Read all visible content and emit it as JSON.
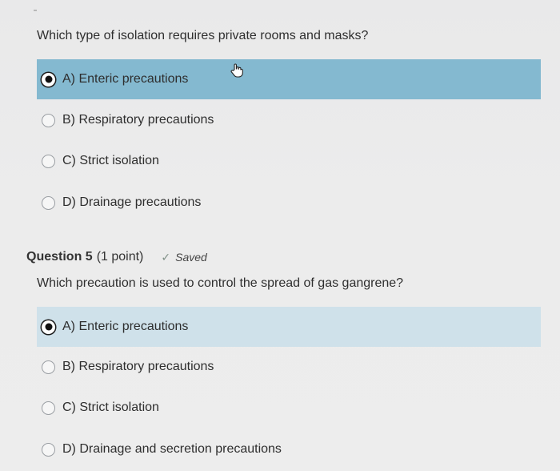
{
  "question4": {
    "prompt": "Which type of isolation requires private rooms and masks?",
    "options": [
      {
        "label": "A) Enteric precautions",
        "selected": true
      },
      {
        "label": "B) Respiratory precautions",
        "selected": false
      },
      {
        "label": "C) Strict isolation",
        "selected": false
      },
      {
        "label": "D) Drainage precautions",
        "selected": false
      }
    ]
  },
  "question5": {
    "title": "Question 5",
    "points": "(1 point)",
    "status": "Saved",
    "prompt": "Which precaution is used to control the spread of gas gangrene?",
    "options": [
      {
        "label": "A) Enteric precautions",
        "selected": true
      },
      {
        "label": "B) Respiratory precautions",
        "selected": false
      },
      {
        "label": "C) Strict isolation",
        "selected": false
      },
      {
        "label": "D) Drainage and secretion precautions",
        "selected": false
      }
    ]
  },
  "icons": {
    "saved": "check-icon",
    "pointer": "hand-cursor-icon"
  },
  "colors": {
    "selected_option_strong": "#84b9d0",
    "selected_option_light": "#cfe1ea",
    "background": "#ececec"
  }
}
